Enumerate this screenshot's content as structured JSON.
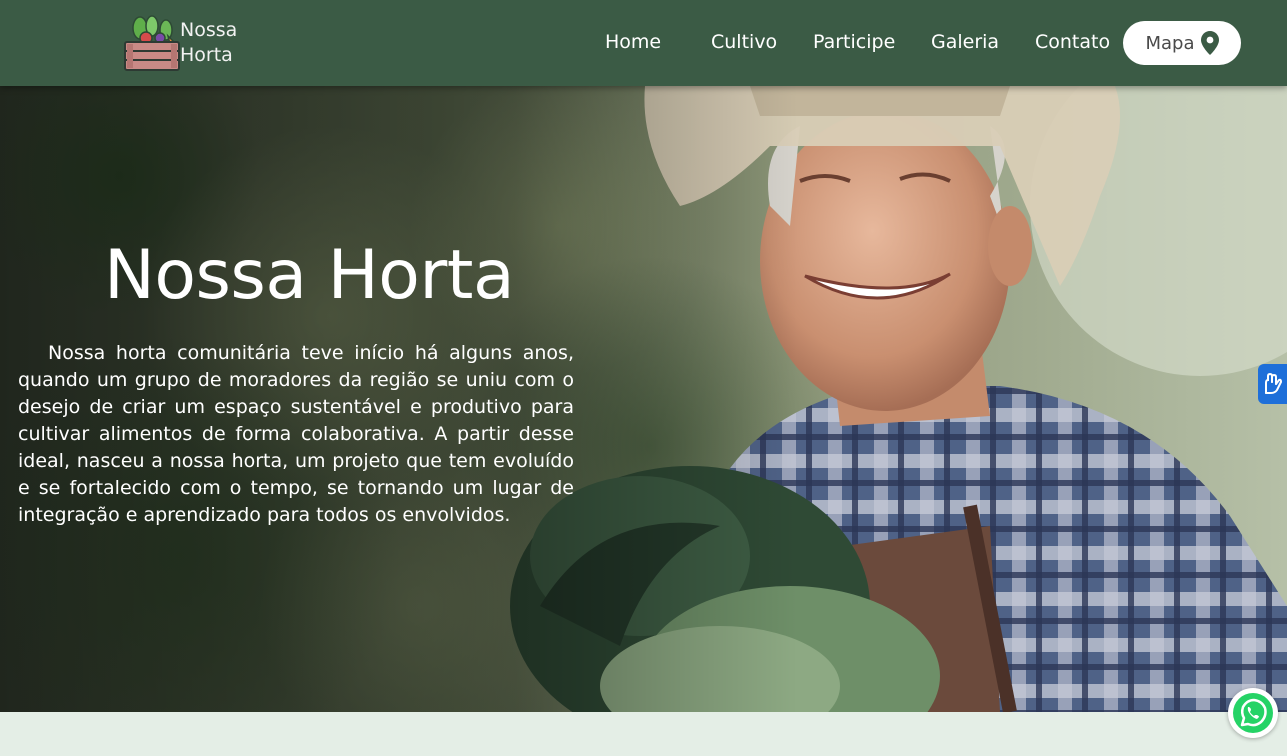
{
  "header": {
    "logo_line1": "Nossa",
    "logo_line2": "Horta",
    "nav": [
      {
        "label": "Home"
      },
      {
        "label": "Cultivo"
      },
      {
        "label": "Participe"
      },
      {
        "label": "Galeria"
      },
      {
        "label": "Contato"
      }
    ],
    "map_button": {
      "label": "Mapa",
      "icon": "location-pin-icon"
    }
  },
  "hero": {
    "title": "Nossa Horta",
    "paragraph": "Nossa horta comunitária teve início há alguns anos, quando um grupo de moradores da região se uniu com o desejo de criar um espaço sustentável e produtivo para cultivar alimentos de forma colaborativa. A partir desse ideal, nasceu a nossa horta, um projeto que tem evoluído e se fortalecido com o tempo, se tornando um lugar de integração e aprendizado para todos os envolvidos."
  },
  "widgets": {
    "accessibility_icon": "sign-language-hands-icon",
    "whatsapp_icon": "whatsapp-icon"
  },
  "colors": {
    "header_bg": "#3b5b45",
    "band_bg": "#e4eee6",
    "accessibility_bg": "#1e6fd9",
    "whatsapp_green": "#25d366"
  }
}
